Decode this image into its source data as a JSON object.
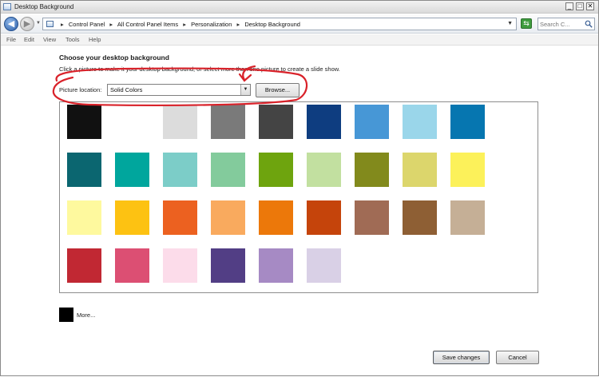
{
  "window": {
    "title": "Desktop Background",
    "controls": {
      "minimize": "_",
      "maximize": "□",
      "close": "✕"
    }
  },
  "addressbar": {
    "breadcrumbs": [
      "Control Panel",
      "All Control Panel Items",
      "Personalization",
      "Desktop Background"
    ],
    "separator": "▸",
    "search_placeholder": "Search C...",
    "icons": {
      "back": "back-arrow-icon",
      "forward": "forward-arrow-icon",
      "refresh": "refresh-icon",
      "search": "search-icon"
    }
  },
  "menubar": {
    "items": [
      "File",
      "Edit",
      "View",
      "Tools",
      "Help"
    ]
  },
  "main": {
    "heading": "Choose your desktop background",
    "subtitle": "Click a picture to make it your desktop background, or select more than one picture to create a slide show.",
    "picture_location_label": "Picture location:",
    "picture_location_value": "Solid Colors",
    "browse_label": "Browse...",
    "annotation_color": "#d9222a"
  },
  "swatches": {
    "rows": [
      [
        "#111111",
        "#ffffff",
        "#dcdcdc",
        "#7a7a7a",
        "#444444",
        "#0e3d80",
        "#4797d6",
        "#9ad6ea",
        "#0676b0"
      ],
      [
        "#0b6670",
        "#00a69d",
        "#7ccdc8",
        "#83cb9c",
        "#6ea40e",
        "#c2e0a0",
        "#828a1c",
        "#dcd66c",
        "#fcf15a"
      ],
      [
        "#fef99e",
        "#fdc212",
        "#ec6120",
        "#f9aa5e",
        "#ec780a",
        "#c5440b",
        "#a06b55",
        "#8e5f34",
        "#c5af96"
      ],
      [
        "#c12833",
        "#dc4f73",
        "#fcdcea",
        "#523e85",
        "#a68ac4",
        "#d9d0e6"
      ]
    ]
  },
  "more": {
    "label": "More...",
    "color": "#000000"
  },
  "buttons": {
    "save": "Save changes",
    "cancel": "Cancel"
  }
}
